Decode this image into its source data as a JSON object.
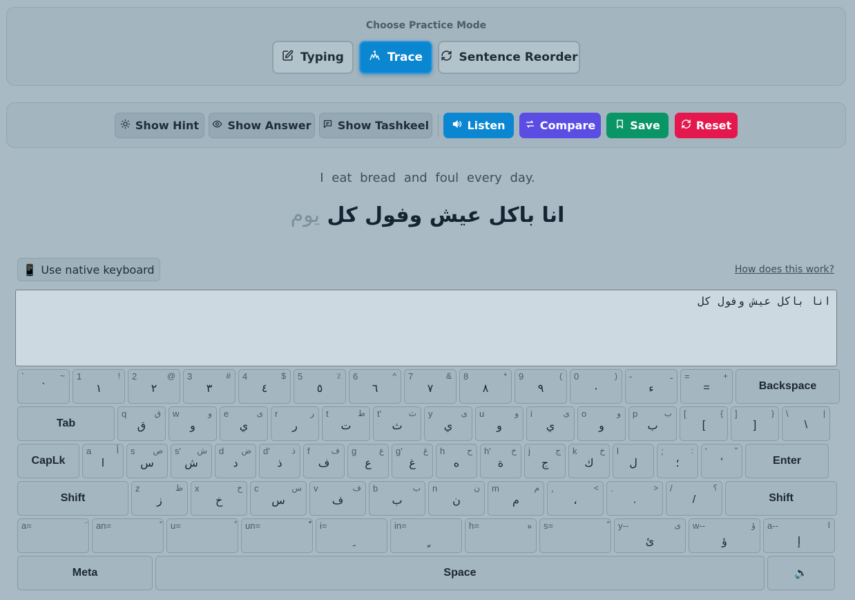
{
  "mode_panel": {
    "title": "Choose Practice Mode",
    "modes": [
      {
        "label": "Typing",
        "icon": "edit-icon",
        "active": false
      },
      {
        "label": "Trace",
        "icon": "trace-icon",
        "active": true
      },
      {
        "label": "Sentence Reorder",
        "icon": "refresh-icon",
        "active": false
      }
    ]
  },
  "toolbar": {
    "show_hint": "Show Hint",
    "show_answer": "Show Answer",
    "show_tashkeel": "Show Tashkeel",
    "listen": "Listen",
    "compare": "Compare",
    "save": "Save",
    "reset": "Reset"
  },
  "sentence": {
    "english": "I eat bread and foul every day.",
    "arabic_typed": "انا باكل عيش وفول كل",
    "arabic_remaining": "يوم"
  },
  "input": {
    "native_keyboard_label": "Use native keyboard",
    "native_keyboard_icon": "📱",
    "help_link": "How does this work?",
    "value": "انا باكل عيش وفول كل"
  },
  "keyboard": {
    "rows": [
      [
        {
          "tl": "`",
          "tr": "~",
          "c": "`"
        },
        {
          "tl": "1",
          "tr": "!",
          "c": "١"
        },
        {
          "tl": "2",
          "tr": "@",
          "c": "٢"
        },
        {
          "tl": "3",
          "tr": "#",
          "c": "٣"
        },
        {
          "tl": "4",
          "tr": "$",
          "c": "٤"
        },
        {
          "tl": "5",
          "tr": "٪",
          "c": "٥"
        },
        {
          "tl": "6",
          "tr": "^",
          "c": "٦"
        },
        {
          "tl": "7",
          "tr": "&",
          "c": "٧"
        },
        {
          "tl": "8",
          "tr": "*",
          "c": "٨"
        },
        {
          "tl": "9",
          "tr": "(",
          "c": "٩"
        },
        {
          "tl": "0",
          "tr": ")",
          "c": "٠"
        },
        {
          "tl": "-",
          "tr": "ـ",
          "c": "ء"
        },
        {
          "tl": "=",
          "tr": "+",
          "c": "="
        },
        {
          "label": "Backspace"
        }
      ],
      [
        {
          "label": "Tab"
        },
        {
          "tl": "q",
          "tr": "ق",
          "c": "ق"
        },
        {
          "tl": "w",
          "tr": "و",
          "c": "و"
        },
        {
          "tl": "e",
          "tr": "ى",
          "c": "ي"
        },
        {
          "tl": "r",
          "tr": "ر",
          "c": "ر"
        },
        {
          "tl": "t",
          "tr": "ط",
          "c": "ت"
        },
        {
          "tl": "t'",
          "tr": "ث",
          "c": "ث"
        },
        {
          "tl": "y",
          "tr": "ى",
          "c": "ي"
        },
        {
          "tl": "u",
          "tr": "و",
          "c": "و"
        },
        {
          "tl": "i",
          "tr": "ى",
          "c": "ي"
        },
        {
          "tl": "o",
          "tr": "و",
          "c": "و"
        },
        {
          "tl": "p",
          "tr": "ب",
          "c": "ب"
        },
        {
          "tl": "[",
          "tr": "{",
          "c": "["
        },
        {
          "tl": "]",
          "tr": "}",
          "c": "]"
        },
        {
          "tl": "\\",
          "tr": "|",
          "c": "\\"
        }
      ],
      [
        {
          "label": "CapLk"
        },
        {
          "tl": "a",
          "tr": "أ",
          "c": "ا"
        },
        {
          "tl": "s",
          "tr": "ص",
          "c": "س"
        },
        {
          "tl": "s'",
          "tr": "ش",
          "c": "ش"
        },
        {
          "tl": "d",
          "tr": "ض",
          "c": "د"
        },
        {
          "tl": "d'",
          "tr": "ذ",
          "c": "ذ"
        },
        {
          "tl": "f",
          "tr": "ف",
          "c": "ف"
        },
        {
          "tl": "g",
          "tr": "ع",
          "c": "ع"
        },
        {
          "tl": "g'",
          "tr": "غ",
          "c": "غ"
        },
        {
          "tl": "h",
          "tr": "ح",
          "c": "ه"
        },
        {
          "tl": "h'",
          "tr": "خ",
          "c": "ة"
        },
        {
          "tl": "j",
          "tr": "ج",
          "c": "ج"
        },
        {
          "tl": "k",
          "tr": "خ",
          "c": "ك"
        },
        {
          "tl": "l",
          "tr": "",
          "c": "ل"
        },
        {
          "tl": ";",
          "tr": ":",
          "c": "؛"
        },
        {
          "tl": "'",
          "tr": "\"",
          "c": "'"
        },
        {
          "label": "Enter"
        }
      ],
      [
        {
          "label": "Shift"
        },
        {
          "tl": "z",
          "tr": "ظ",
          "c": "ز"
        },
        {
          "tl": "x",
          "tr": "خ",
          "c": "خ"
        },
        {
          "tl": "c",
          "tr": "س",
          "c": "س"
        },
        {
          "tl": "v",
          "tr": "ف",
          "c": "ف"
        },
        {
          "tl": "b",
          "tr": "ب",
          "c": "ب"
        },
        {
          "tl": "n",
          "tr": "ن",
          "c": "ن"
        },
        {
          "tl": "m",
          "tr": "م",
          "c": "م"
        },
        {
          "tl": ",",
          "tr": "<",
          "c": "،"
        },
        {
          "tl": ".",
          "tr": ">",
          "c": "."
        },
        {
          "tl": "/",
          "tr": "؟",
          "c": "/"
        },
        {
          "label": "Shift"
        }
      ],
      [
        {
          "tl": "a=",
          "tr": "َ",
          "b": ""
        },
        {
          "tl": "an=",
          "tr": "ً",
          "b": ""
        },
        {
          "tl": "u=",
          "tr": "ُ",
          "b": ""
        },
        {
          "tl": "un=",
          "tr": "ٌّ",
          "b": ""
        },
        {
          "tl": "i=",
          "tr": "",
          "b": "ِ"
        },
        {
          "tl": "in=",
          "tr": "",
          "b": "ٍ"
        },
        {
          "tl": "h=",
          "tr": "ه",
          "b": ""
        },
        {
          "tl": "s=",
          "tr": "ّ",
          "b": ""
        },
        {
          "tl": "y--",
          "tr": "ى",
          "b": "ئ"
        },
        {
          "tl": "w--",
          "tr": "ؤ",
          "b": "ؤ"
        },
        {
          "tl": "a--",
          "tr": "ا",
          "b": "إ"
        }
      ],
      [
        {
          "label": "Meta"
        },
        {
          "label": "Space"
        },
        {
          "label": "🔈"
        }
      ]
    ]
  }
}
